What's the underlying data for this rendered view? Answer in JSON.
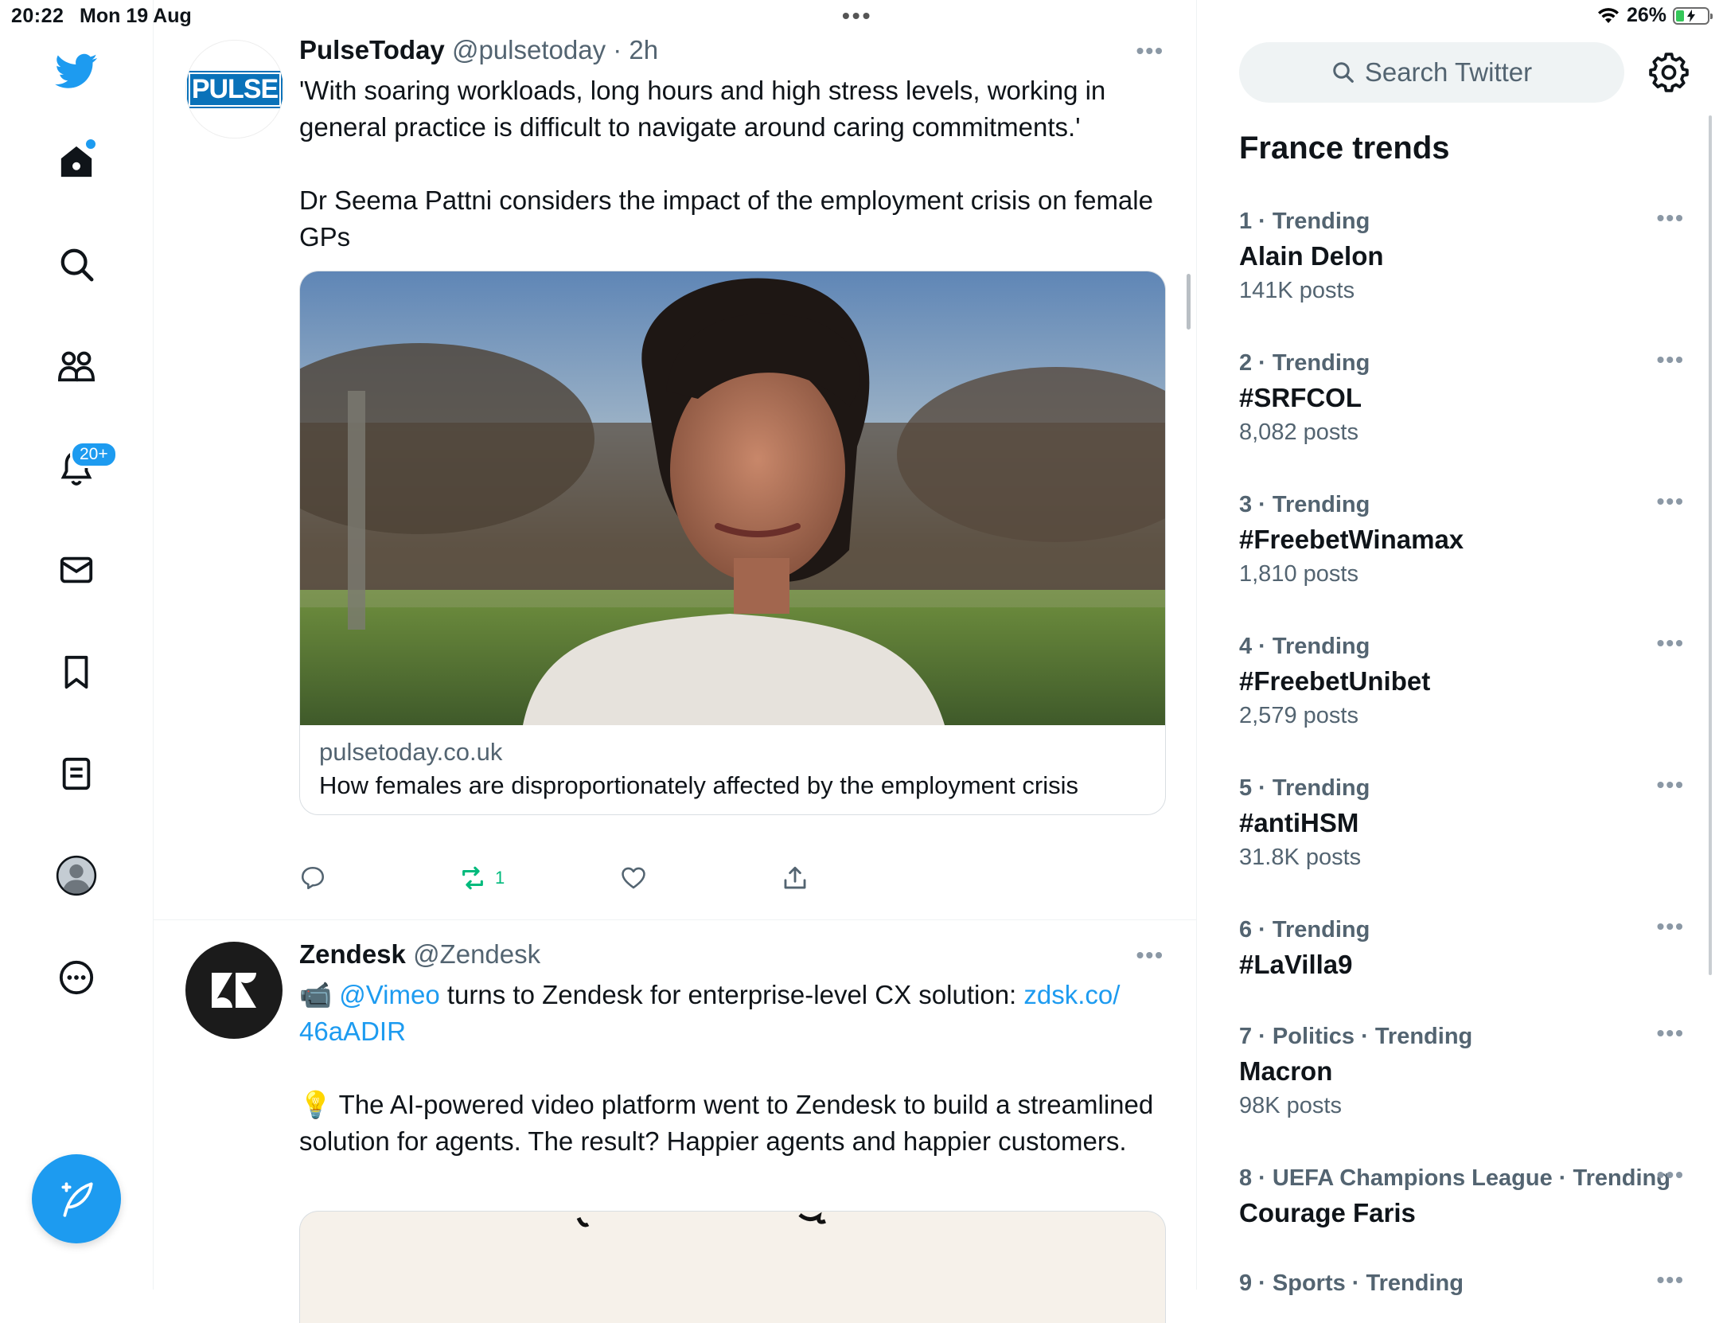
{
  "status_bar": {
    "time": "20:22",
    "date": "Mon 19 Aug",
    "battery": "26%",
    "battery_level": 0.26
  },
  "nav": {
    "home_badge": true,
    "notifications_badge": "20+"
  },
  "feed": {
    "tweets": [
      {
        "name": "PulseToday",
        "handle": "@pulsetoday",
        "time": "· 2h",
        "avatar_text": "PULSE",
        "text_1": "'With soaring workloads, long hours and high stress levels, working in general practice is difficult to navigate around caring commitments.'",
        "text_2": "Dr Seema Pattni considers the impact of the employment crisis on female GPs",
        "card_domain": "pulsetoday.co.uk",
        "card_title": "How females are disproportionately affected by the employment crisis",
        "retweets": "1"
      },
      {
        "name": "Zendesk",
        "handle": "@Zendesk",
        "text_emoji": "📹",
        "mention": "@Vimeo",
        "text_a": " turns to Zendesk for enterprise-level CX solution: ",
        "link_a": "zdsk.co/",
        "link_b": "46aADIR",
        "text_b_emoji": "💡",
        "text_b": " The AI-powered video platform went to Zendesk to build a streamlined solution for agents. The result? Happier agents and happier customers."
      }
    ]
  },
  "sidebar": {
    "search_placeholder": "Search Twitter",
    "title": "France trends",
    "trends": [
      {
        "context": "1 · Trending",
        "name": "Alain Delon",
        "count": "141K posts"
      },
      {
        "context": "2 · Trending",
        "name": "#SRFCOL",
        "count": "8,082 posts"
      },
      {
        "context": "3 · Trending",
        "name": "#FreebetWinamax",
        "count": "1,810 posts"
      },
      {
        "context": "4 · Trending",
        "name": "#FreebetUnibet",
        "count": "2,579 posts"
      },
      {
        "context": "5 · Trending",
        "name": "#antiHSM",
        "count": "31.8K posts"
      },
      {
        "context": "6 · Trending",
        "name": "#LaVilla9",
        "count": ""
      },
      {
        "context": "7 · Politics · Trending",
        "name": "Macron",
        "count": "98K posts"
      },
      {
        "context": "8 · UEFA Champions League · Trending",
        "name": "Courage Faris",
        "count": ""
      },
      {
        "context": "9 · Sports · Trending",
        "name": "",
        "count": ""
      }
    ]
  },
  "colors": {
    "accent": "#1d9bf0",
    "retweet": "#00ba7c",
    "text": "#0f1419",
    "muted": "#536471"
  }
}
